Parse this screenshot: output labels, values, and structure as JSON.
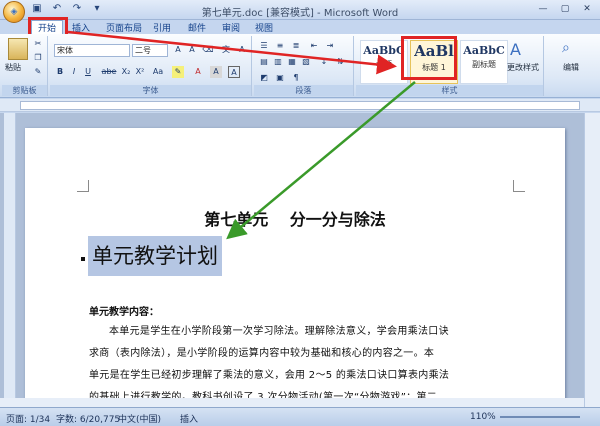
{
  "window": {
    "title": "第七单元.doc [兼容模式] - Microsoft Word",
    "office_button_icon": "office-logo-icon"
  },
  "quick_access": [
    "save-icon",
    "undo-icon",
    "redo-icon",
    "customize-icon"
  ],
  "tabs": [
    {
      "label": "开始",
      "active": true
    },
    {
      "label": "插入"
    },
    {
      "label": "页面布局"
    },
    {
      "label": "引用"
    },
    {
      "label": "邮件"
    },
    {
      "label": "审阅"
    },
    {
      "label": "视图"
    }
  ],
  "ribbon": {
    "clipboard": {
      "paste_label": "粘贴",
      "group_label": "剪贴板"
    },
    "font": {
      "font_name": "宋体",
      "font_size": "二号",
      "group_label": "字体",
      "format_buttons": [
        "B",
        "I",
        "U",
        "abe",
        "X₂",
        "X²",
        "Aa",
        "A",
        "A",
        "A"
      ]
    },
    "paragraph": {
      "group_label": "段落"
    },
    "styles": {
      "group_label": "样式",
      "items": [
        {
          "sample": "AaBbC",
          "label": "标题"
        },
        {
          "sample": "AaBl",
          "label": "标题 1"
        },
        {
          "sample": "AaBbC",
          "label": "副标题"
        }
      ],
      "change_styles_label": "更改样式"
    },
    "editing": {
      "label": "编辑"
    }
  },
  "document": {
    "title": "第七单元　 分一分与除法",
    "heading": "单元教学计划",
    "section_label": "单元教学内容：",
    "paragraph_lines": [
      "本单元是学生在小学阶段第一次学习除法。理解除法意义，学会用乘法口诀",
      "求商（表内除法），是小学阶段的运算内容中较为基础和核心的内容之一。本",
      "单元是在学生已经初步理解了乘法的意义，会用 2～5 的乘法口诀口算表内乘法",
      "的基础上进行教学的。教科书创设了 3 次分物活动(第一次“分物游戏”；第二"
    ]
  },
  "statusbar": {
    "page": "页面: 1/34",
    "words": "字数: 6/20,775",
    "language": "中文(中国)",
    "mode": "插入",
    "zoom": "110%"
  },
  "colors": {
    "highlight_red": "#e02424",
    "annotation_green": "#3a9a2a",
    "selection_blue": "#b5c6e3"
  }
}
